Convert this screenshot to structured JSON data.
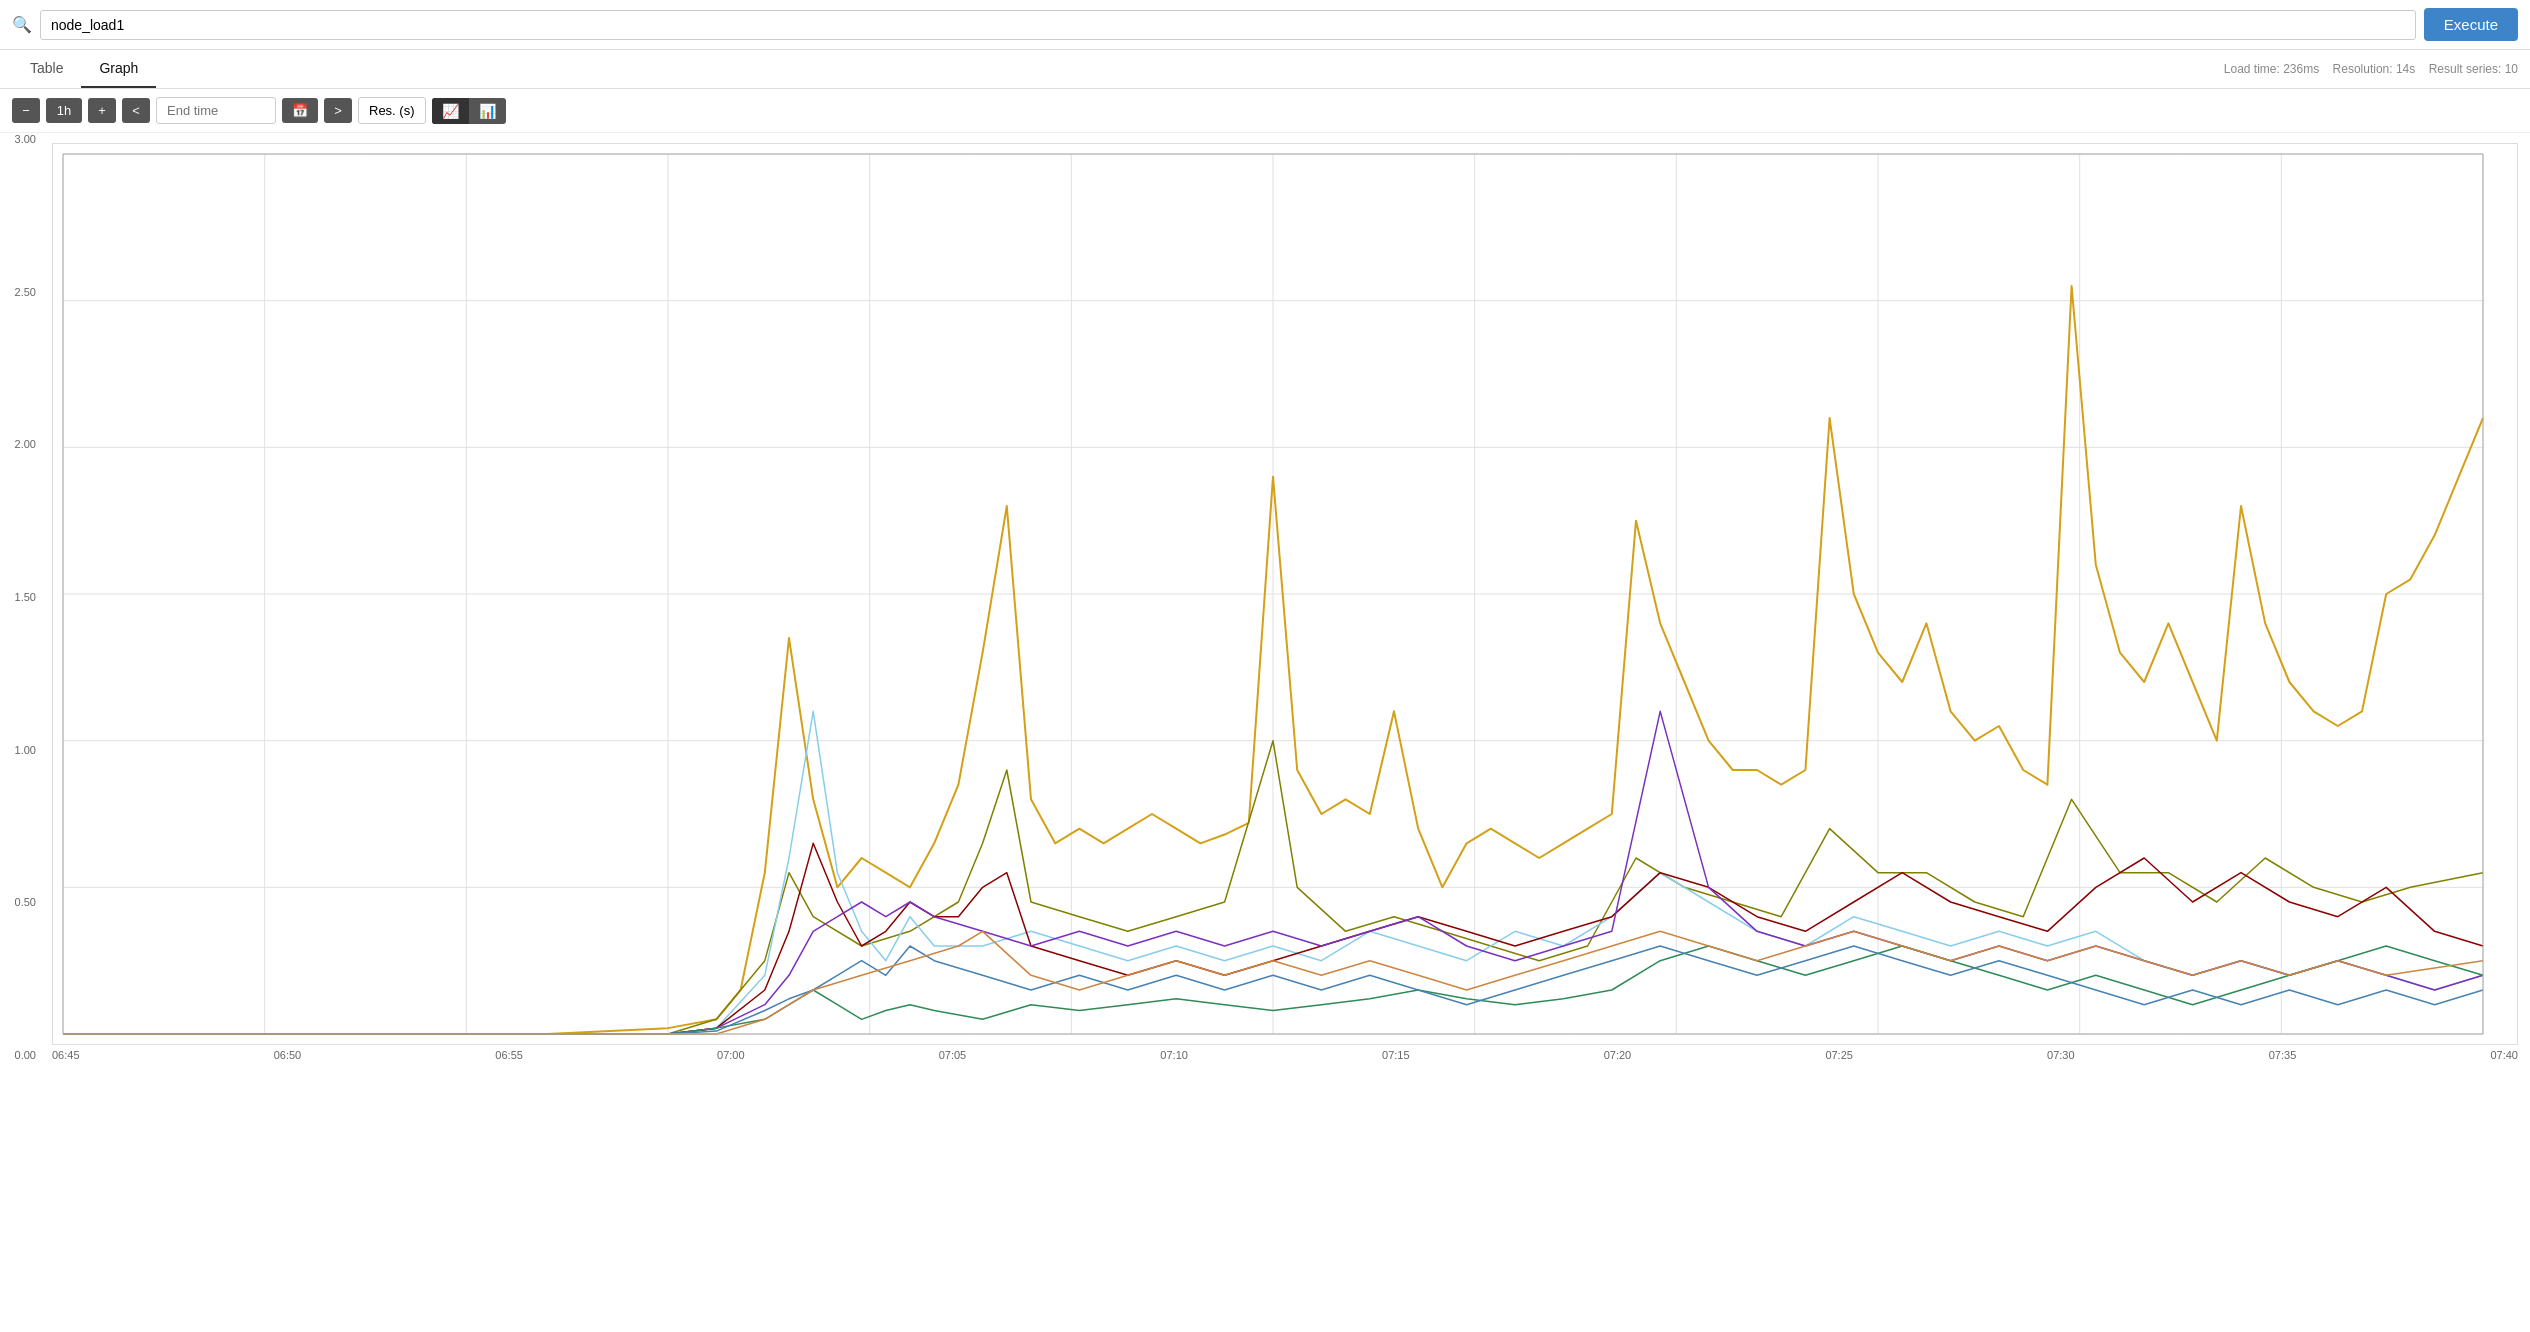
{
  "header": {
    "query": "node_load1",
    "execute_label": "Execute"
  },
  "tabs": [
    {
      "id": "table",
      "label": "Table",
      "active": false
    },
    {
      "id": "graph",
      "label": "Graph",
      "active": true
    }
  ],
  "meta": {
    "load_time": "Load time: 236ms",
    "resolution": "Resolution: 14s",
    "result_series": "Result series: 10"
  },
  "controls": {
    "minus_label": "−",
    "duration_label": "1h",
    "plus_label": "+",
    "prev_label": "<",
    "end_time_placeholder": "End time",
    "next_label": ">",
    "res_label": "Res. (s)"
  },
  "chart": {
    "y_axis": [
      "3.00",
      "2.50",
      "2.00",
      "1.50",
      "1.00",
      "0.50",
      "0.00"
    ],
    "x_axis": [
      "06:45",
      "06:50",
      "06:55",
      "07:00",
      "07:05",
      "07:10",
      "07:15",
      "07:20",
      "07:25",
      "07:30",
      "07:35",
      "07:40"
    ]
  }
}
